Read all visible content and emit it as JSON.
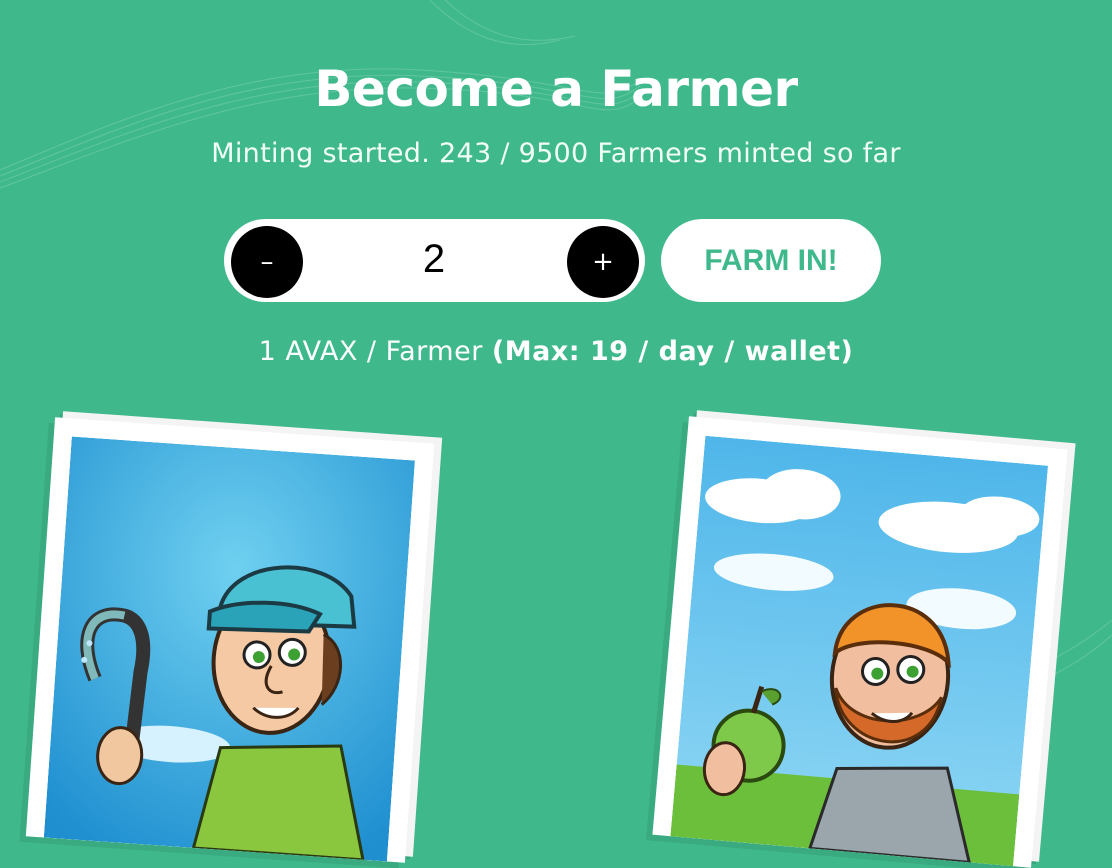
{
  "hero": {
    "title": "Become a Farmer",
    "subtitle": "Minting started. 243 / 9500 Farmers minted so far"
  },
  "mint": {
    "decrement_label": "–",
    "quantity": "2",
    "increment_label": "+",
    "button_label": "FARM IN!"
  },
  "price": {
    "text": "1 AVAX / Farmer ",
    "limit": "(Max: 19 / day / wallet)"
  },
  "cards": [
    {
      "name": "farmer-cap",
      "icon": "farmer-with-hose-illustration"
    },
    {
      "name": "farmer-beard",
      "icon": "farmer-with-apple-illustration"
    }
  ],
  "colors": {
    "background": "#3fb98c",
    "button_text": "#3fb98c",
    "stepper_button": "#000000"
  }
}
